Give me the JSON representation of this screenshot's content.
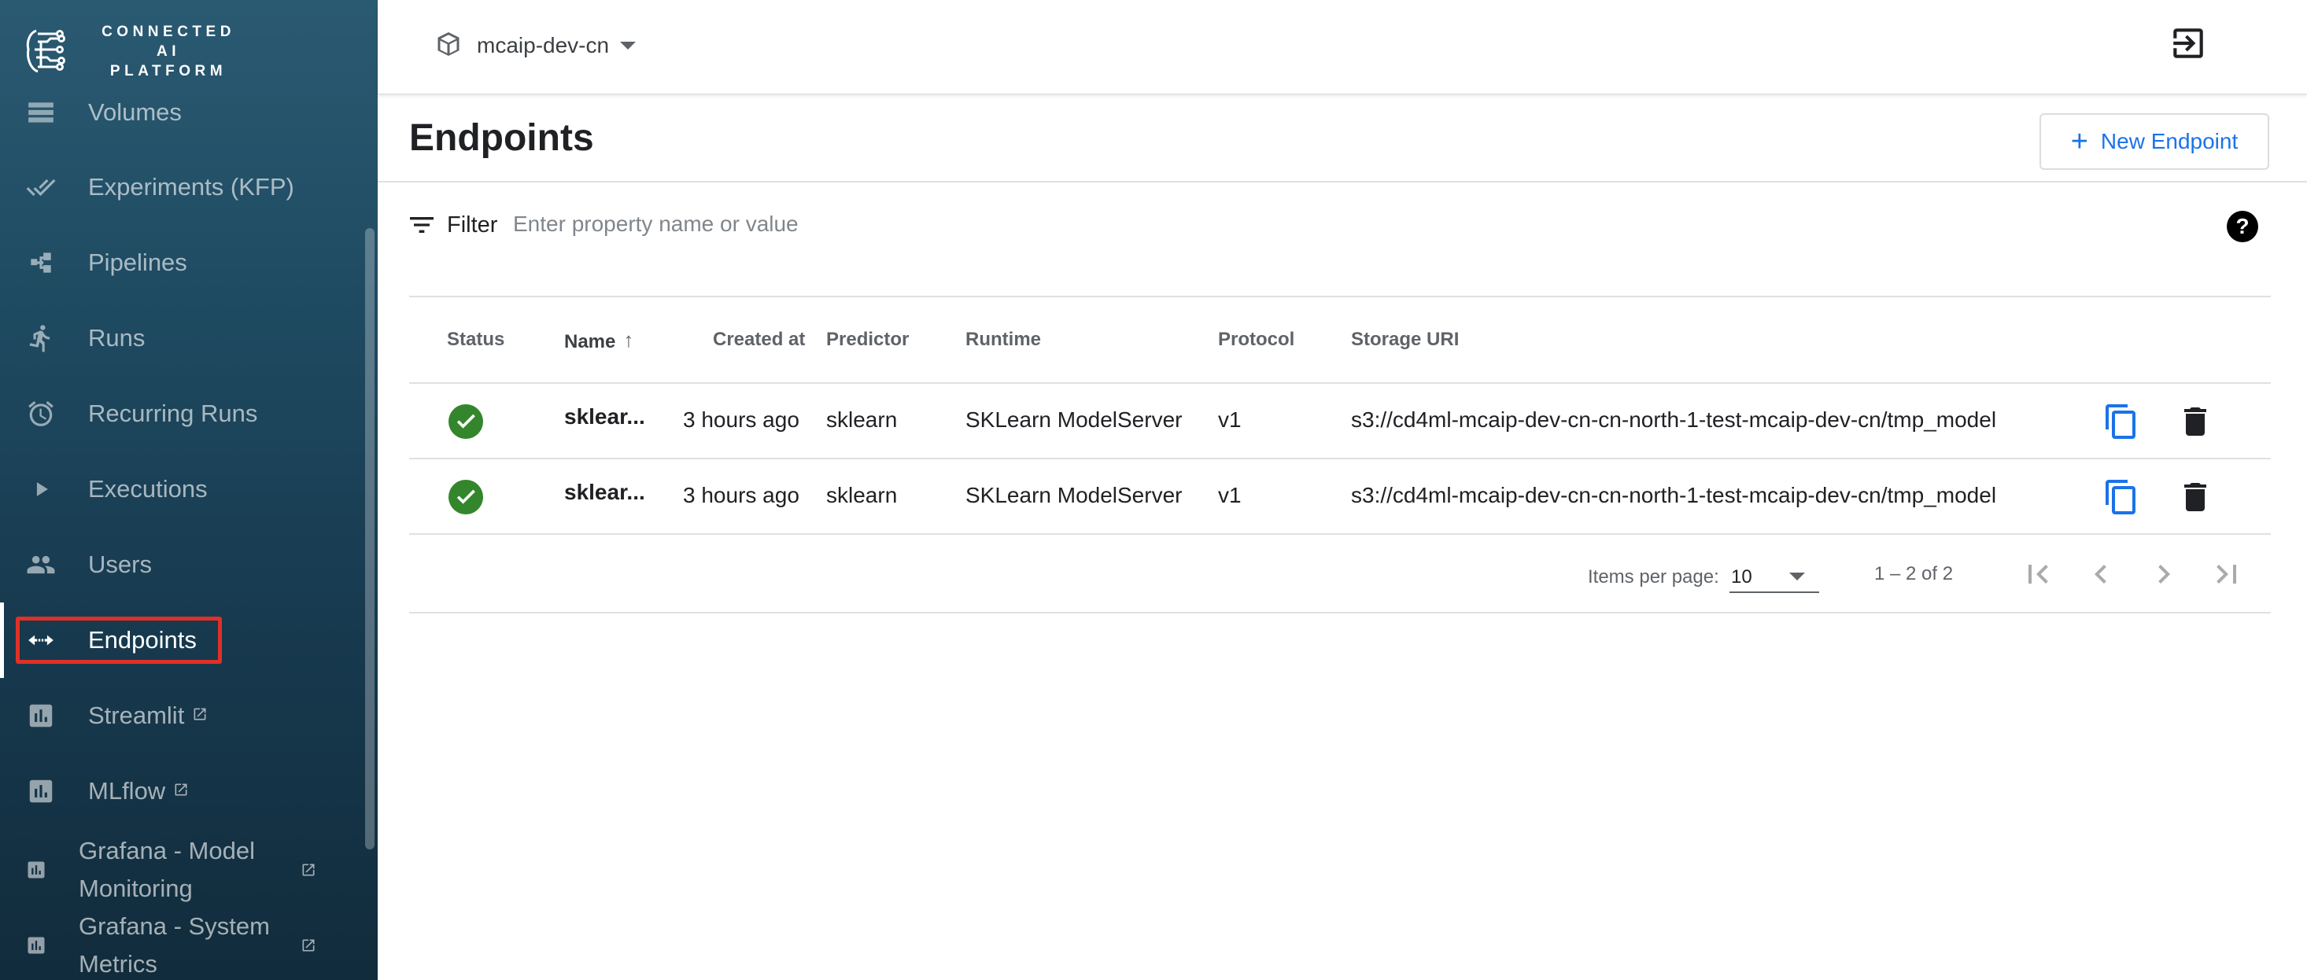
{
  "brand": {
    "line1": "CONNECTED AI",
    "line2": "PLATFORM"
  },
  "sidebar": {
    "items": [
      {
        "label": "Volumes",
        "icon": "storage-icon"
      },
      {
        "label": "Experiments (KFP)",
        "icon": "done-all-icon"
      },
      {
        "label": "Pipelines",
        "icon": "device-hub-icon"
      },
      {
        "label": "Runs",
        "icon": "directions-run-icon"
      },
      {
        "label": "Recurring Runs",
        "icon": "alarm-icon"
      },
      {
        "label": "Executions",
        "icon": "play-arrow-icon"
      },
      {
        "label": "Users",
        "icon": "people-icon"
      },
      {
        "label": "Endpoints",
        "icon": "code-arrows-icon",
        "active": true
      },
      {
        "label": "Streamlit",
        "icon": "bar-chart-icon",
        "external": true
      },
      {
        "label": "MLflow",
        "icon": "bar-chart-icon",
        "external": true
      },
      {
        "label": "Grafana - Model Monitoring",
        "icon": "bar-chart-icon",
        "external": true
      },
      {
        "label": "Grafana - System Metrics",
        "icon": "bar-chart-icon",
        "external": true
      }
    ]
  },
  "topbar": {
    "namespace": "mcaip-dev-cn"
  },
  "page": {
    "title": "Endpoints",
    "new_button": "New Endpoint"
  },
  "filter": {
    "label": "Filter",
    "placeholder": "Enter property name or value"
  },
  "table": {
    "columns": [
      "Status",
      "Name",
      "Created at",
      "Predictor",
      "Runtime",
      "Protocol",
      "Storage URI"
    ],
    "rows": [
      {
        "status": "ready",
        "name": "sklear...",
        "created": "3 hours ago",
        "predictor": "sklearn",
        "runtime": "SKLearn ModelServer",
        "protocol": "v1",
        "storage_uri": "s3://cd4ml-mcaip-dev-cn-cn-north-1-test-mcaip-dev-cn/tmp_model"
      },
      {
        "status": "ready",
        "name": "sklear...",
        "created": "3 hours ago",
        "predictor": "sklearn",
        "runtime": "SKLearn ModelServer",
        "protocol": "v1",
        "storage_uri": "s3://cd4ml-mcaip-dev-cn-cn-north-1-test-mcaip-dev-cn/tmp_model"
      }
    ]
  },
  "paginator": {
    "items_per_page_label": "Items per page:",
    "page_size": "10",
    "range": "1 – 2 of 2"
  },
  "colors": {
    "accent": "#1a73e8",
    "status_ok": "#34862c",
    "highlight": "#e03027"
  }
}
